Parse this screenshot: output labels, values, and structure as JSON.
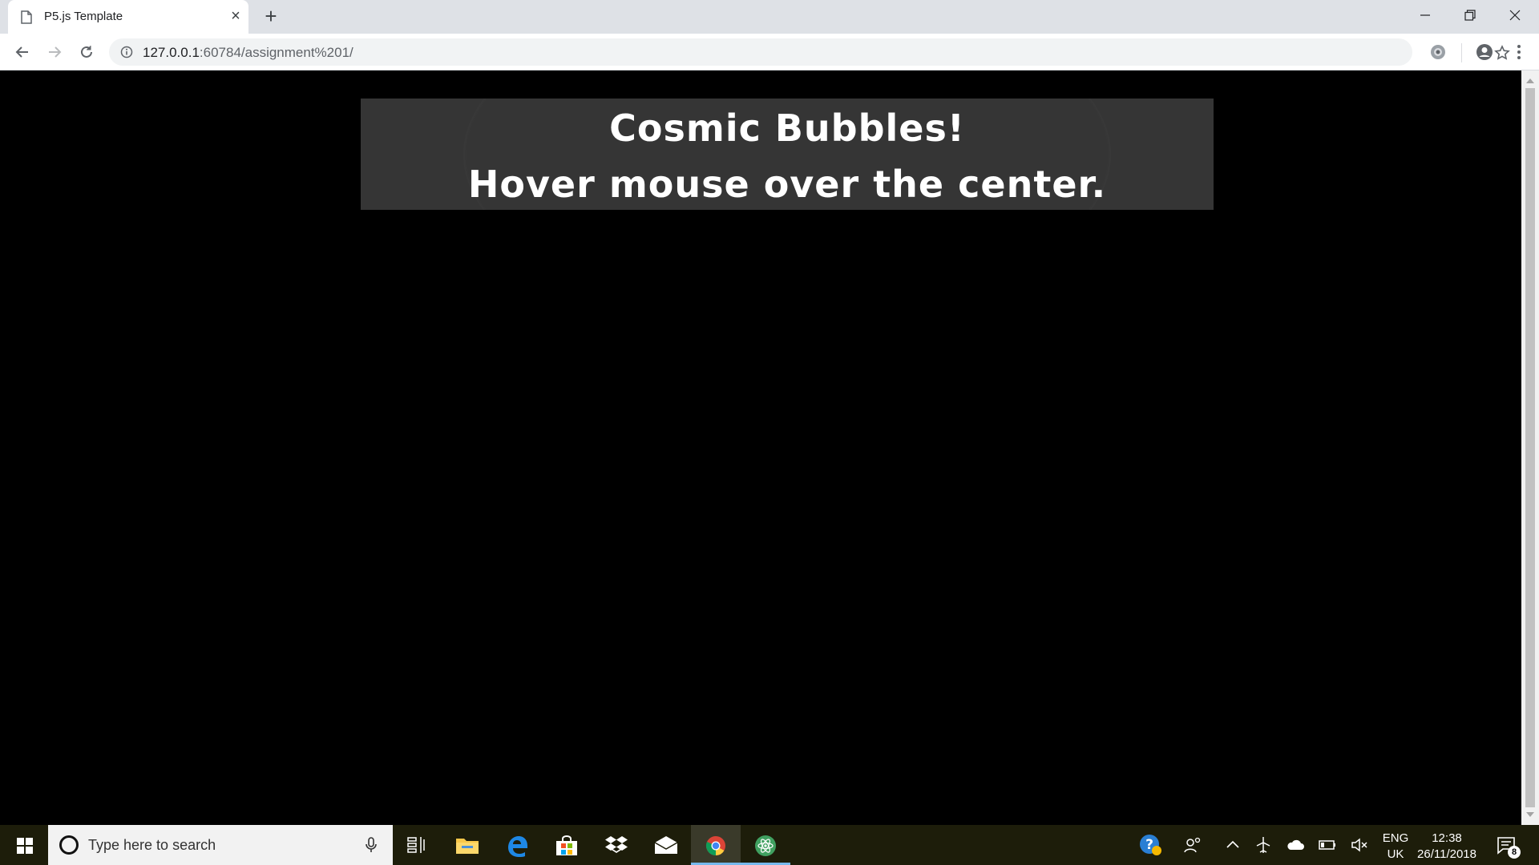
{
  "browser": {
    "tab": {
      "title": "P5.js Template",
      "icon": "page-icon"
    },
    "address": {
      "host": "127.0.0.1",
      "rest": ":60784/assignment%201/"
    }
  },
  "page": {
    "title_line": "Cosmic Bubbles!",
    "instruction_line": "Hover mouse over the center."
  },
  "taskbar": {
    "search_placeholder": "Type here to search",
    "apps": [
      "task-view",
      "file-explorer",
      "edge",
      "store",
      "dropbox",
      "mail",
      "chrome",
      "atom"
    ],
    "language": {
      "line1": "ENG",
      "line2": "UK"
    },
    "clock": {
      "time": "12:38",
      "date": "26/11/2018"
    },
    "notifications_count": "8"
  },
  "colors": {
    "page_background": "#000000",
    "canvas_background": "#353535",
    "taskbar": "#1d1d0a",
    "accent": "#76b9ed"
  }
}
